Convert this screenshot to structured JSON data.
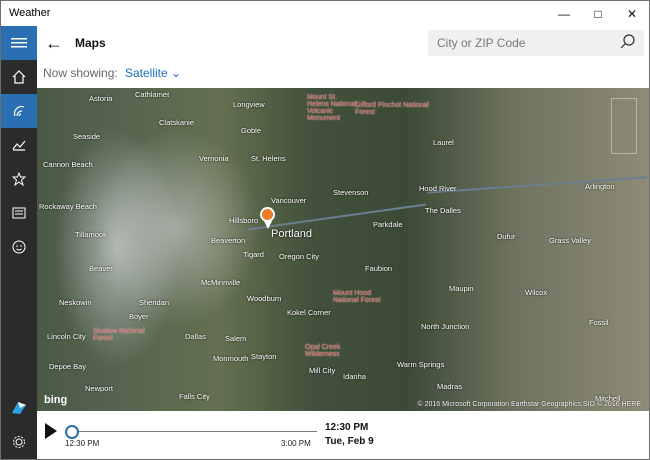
{
  "window": {
    "title": "Weather",
    "minimize": "—",
    "maximize": "□",
    "close": "✕"
  },
  "sidebar": {
    "items": [
      {
        "name": "hamburger-menu-icon"
      },
      {
        "name": "home-icon"
      },
      {
        "name": "maps-icon"
      },
      {
        "name": "historical-weather-icon"
      },
      {
        "name": "places-icon"
      },
      {
        "name": "news-icon"
      },
      {
        "name": "feedback-icon"
      },
      {
        "name": "msn-logo-icon"
      },
      {
        "name": "settings-gear-icon"
      }
    ]
  },
  "header": {
    "title": "Maps",
    "search_placeholder": "City or ZIP Code"
  },
  "showing": {
    "label": "Now showing:",
    "value": "Satellite"
  },
  "map": {
    "labels": [
      "Astoria",
      "Cathlamet",
      "Longview",
      "Mount St. Helens National Volcanic Monument",
      "Gifford Pinchot National Forest",
      "Seaside",
      "Clatskanie",
      "Goble",
      "Laurel",
      "Cannon Beach",
      "Vernonia",
      "St. Helens",
      "Vancouver",
      "Stevenson",
      "Hood River",
      "Arlington",
      "Rockaway Beach",
      "Hillsboro",
      "Portland",
      "Parkdale",
      "The Dalles",
      "Tillamook",
      "Beaverton",
      "Oregon City",
      "Faubion",
      "Dufur",
      "Tigard",
      "Grass Valley",
      "Beaver",
      "McMinnville",
      "Neskowin",
      "Sheridan",
      "Woodburn",
      "Mount Hood National Forest",
      "Maupin",
      "Wilcox",
      "Boyer",
      "Kokel Corner",
      "Lincoln City",
      "Siuslaw National Forest",
      "Dallas",
      "North Junction",
      "Fossil",
      "Salem",
      "Depoe Bay",
      "Monmouth",
      "Stayton",
      "Opal Creek Wilderness",
      "Warm Springs",
      "Newport",
      "Mill City",
      "Idanha",
      "Madras",
      "Mitchell",
      "Falls City"
    ],
    "bing": "bing",
    "copyright": "© 2016 Microsoft Corporation   Earthstar Geographics SIO   © 2016 HERE"
  },
  "timeline": {
    "start": "12:30 PM",
    "end": "3:00 PM",
    "current_time": "12:30 PM",
    "current_date": "Tue, Feb 9",
    "progress": 0
  }
}
